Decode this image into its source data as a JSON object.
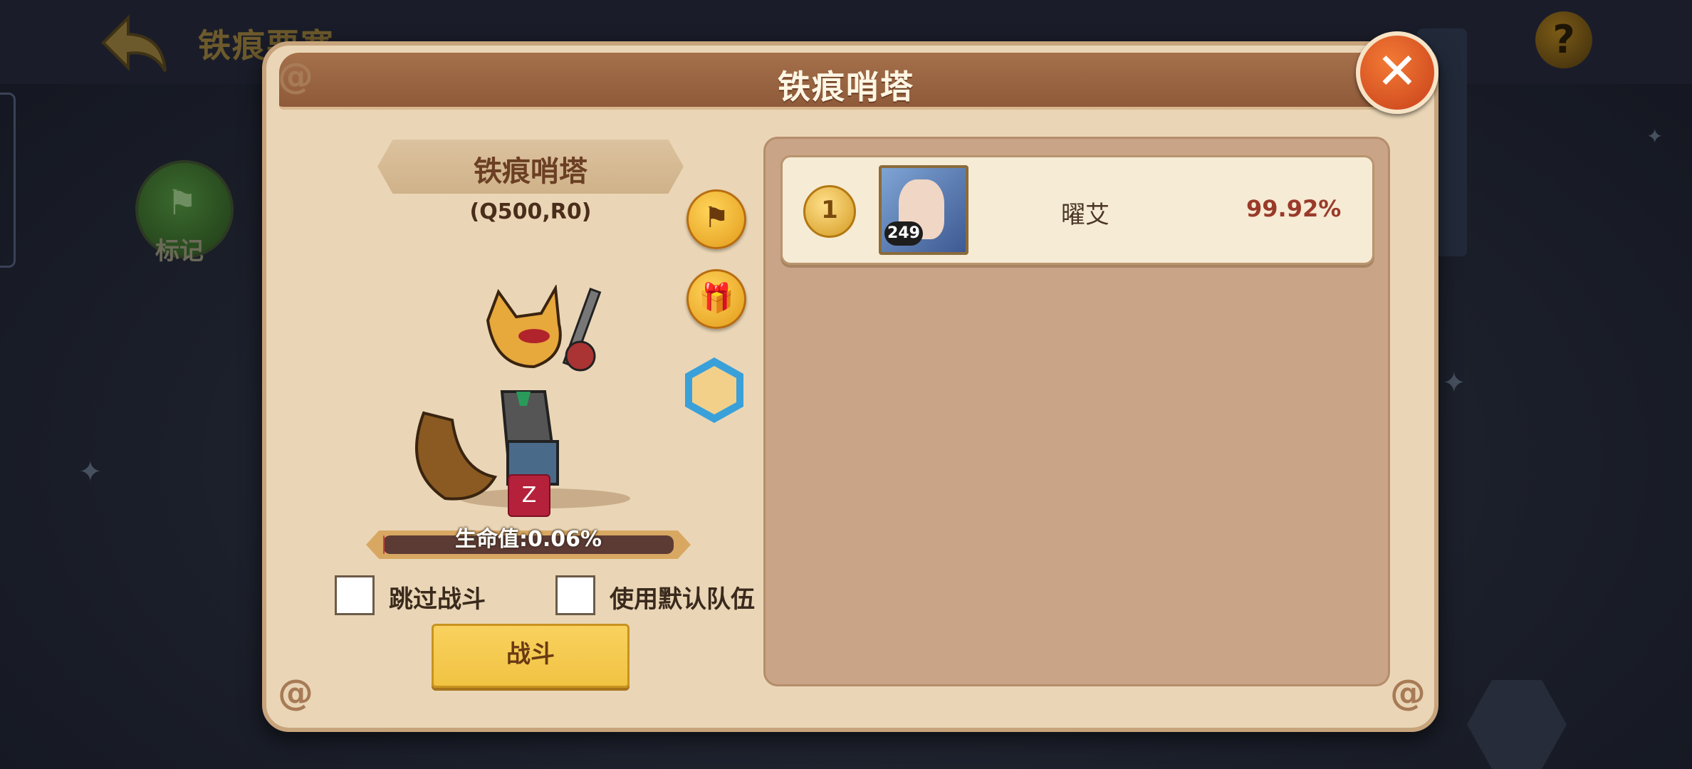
{
  "header": {
    "title": "铁痕要塞",
    "help_symbol": "?"
  },
  "side": {
    "mark_label": "标记"
  },
  "dialog": {
    "title": "铁痕哨塔",
    "close_symbol": "✕",
    "boss": {
      "name": "铁痕哨塔",
      "code": "(Q500,R0)",
      "hp_label": "生命值:0.06%",
      "hp_percent": 0.06,
      "debuff_symbol": "Z"
    },
    "action_icons": [
      "flag-icon",
      "gift-icon",
      "hero-badge-icon"
    ],
    "options": {
      "skip_battle": "跳过战斗",
      "use_default_team": "使用默认队伍"
    },
    "fight_label": "战斗",
    "ranking": [
      {
        "rank": "1",
        "level": "249",
        "name": "曜艾",
        "percent": "99.92%"
      }
    ]
  },
  "colors": {
    "accent_yellow": "#f1c343",
    "header_brown": "#8e5a39",
    "close_orange": "#e05a26",
    "percent_red": "#9a3a2a"
  }
}
